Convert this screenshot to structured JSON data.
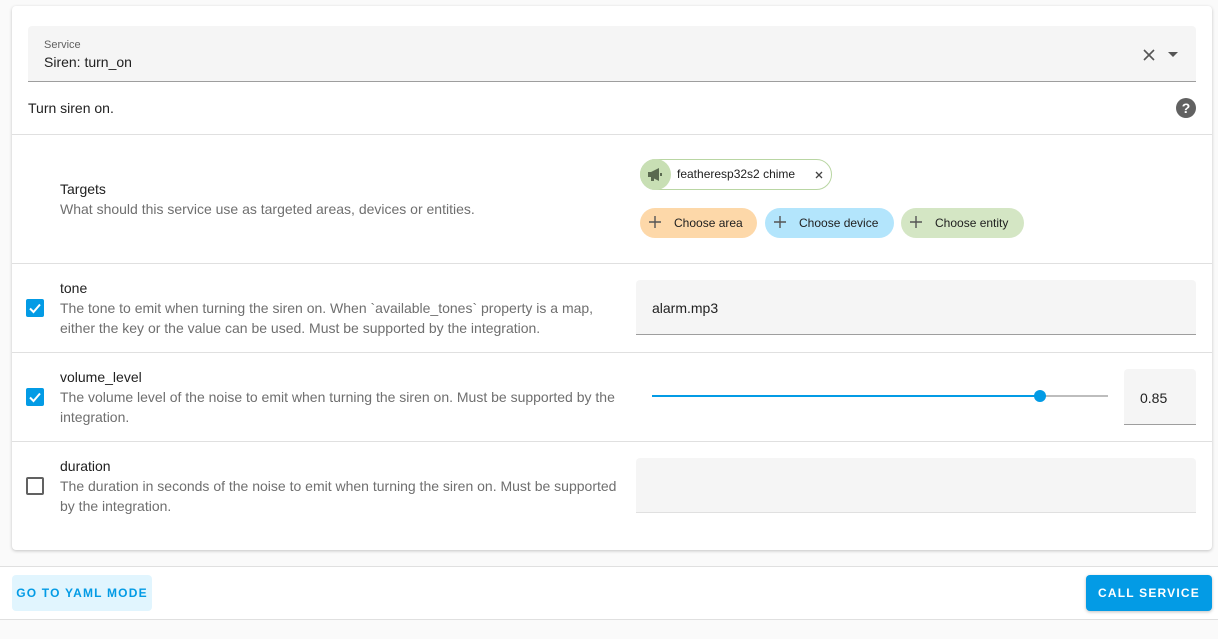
{
  "service_select": {
    "label": "Service",
    "value": "Siren: turn_on"
  },
  "service_description": "Turn siren on.",
  "help_icon_glyph": "?",
  "targets": {
    "title": "Targets",
    "description": "What should this service use as targeted areas, devices or entities.",
    "selected": [
      {
        "label": "featheresp32s2 chime",
        "icon": "bullhorn-icon"
      }
    ],
    "add_area": "Choose area",
    "add_device": "Choose device",
    "add_entity": "Choose entity"
  },
  "fields": {
    "tone": {
      "name": "tone",
      "description": "The tone to emit when turning the siren on. When `available_tones` property is a map, either the key or the value can be used. Must be supported by the integration.",
      "checked": true,
      "value": "alarm.mp3"
    },
    "volume_level": {
      "name": "volume_level",
      "description": "The volume level of the noise to emit when turning the siren on. Must be supported by the integration.",
      "checked": true,
      "value": 0.85,
      "display_value": "0.85"
    },
    "duration": {
      "name": "duration",
      "description": "The duration in seconds of the noise to emit when turning the siren on. Must be supported by the integration.",
      "checked": false,
      "value": ""
    }
  },
  "footer": {
    "yaml_button": "GO TO YAML MODE",
    "call_button": "CALL SERVICE"
  },
  "colors": {
    "primary": "#039be5",
    "area_chip": "#fdd8a9",
    "device_chip": "#b3e5fc",
    "entity_chip": "#d4e6c4"
  }
}
